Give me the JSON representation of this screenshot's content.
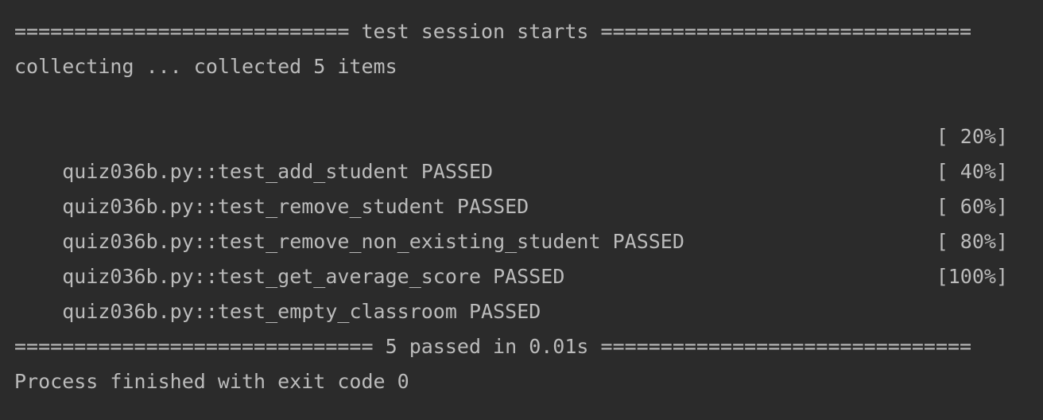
{
  "console": {
    "header_line": "============================ test session starts ===============================",
    "collecting_line": "collecting ... collected 5 items",
    "results": [
      {
        "test": "quiz036b.py::test_add_student",
        "status": "PASSED",
        "progress": "[ 20%]"
      },
      {
        "test": "quiz036b.py::test_remove_student",
        "status": "PASSED",
        "progress": "[ 40%]"
      },
      {
        "test": "quiz036b.py::test_remove_non_existing_student",
        "status": "PASSED",
        "progress": "[ 60%]"
      },
      {
        "test": "quiz036b.py::test_get_average_score",
        "status": "PASSED",
        "progress": "[ 80%]"
      },
      {
        "test": "quiz036b.py::test_empty_classroom",
        "status": "PASSED",
        "progress": "[100%]"
      }
    ],
    "summary_line": "============================== 5 passed in 0.01s ===============================",
    "exit_line": "Process finished with exit code 0"
  },
  "colors": {
    "background": "#2b2b2b",
    "text": "#bbbbbb"
  }
}
